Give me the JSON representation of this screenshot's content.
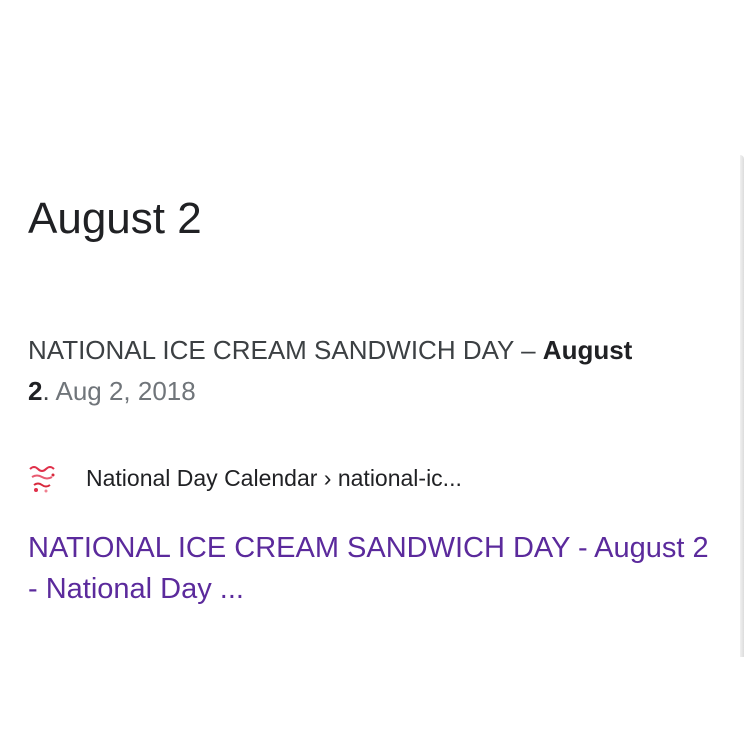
{
  "answer": {
    "title": "August 2"
  },
  "snippet": {
    "text_before": "NATIONAL ICE CREAM SANDWICH DAY – ",
    "bold_1": "August",
    "bold_2": "2",
    "text_after": ". ",
    "date": "Aug 2, 2018"
  },
  "source": {
    "icon": "national-day-calendar-logo",
    "breadcrumb": "National Day Calendar › national-ic..."
  },
  "result": {
    "link_text": "NATIONAL ICE CREAM SANDWICH DAY - August 2 - National Day ..."
  },
  "colors": {
    "link": "#5b2a9c",
    "title": "#202124",
    "snippet": "#3c4043",
    "date": "#70757a"
  }
}
